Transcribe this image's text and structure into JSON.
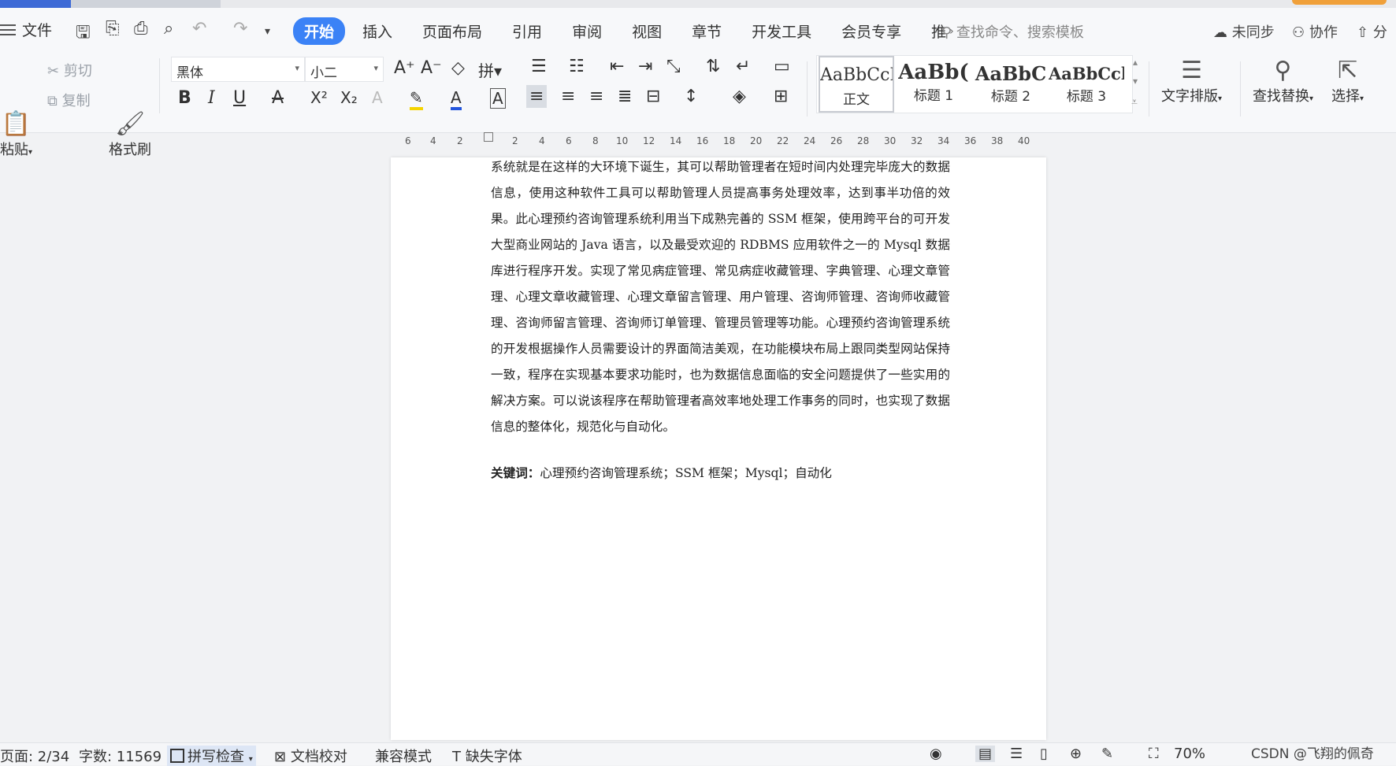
{
  "menu": {
    "file_label": "文件",
    "tabs": [
      "开始",
      "插入",
      "页面布局",
      "引用",
      "审阅",
      "视图",
      "章节",
      "开发工具",
      "会员专享",
      "推"
    ],
    "active_tab": "开始",
    "search_placeholder": "查找命令、搜索模板",
    "sync_status": "未同步",
    "collab": "协作",
    "share": "分"
  },
  "ribbon": {
    "paste": "粘贴",
    "cut": "剪切",
    "copy": "复制",
    "format_painter": "格式刷",
    "font_name": "黑体",
    "font_size": "小二",
    "styles": [
      {
        "preview": "AaBbCcI",
        "name": "正文"
      },
      {
        "preview": "AaBb(",
        "name": "标题 1"
      },
      {
        "preview": "AaBbC",
        "name": "标题 2"
      },
      {
        "preview": "AaBbCcl",
        "name": "标题 3"
      }
    ],
    "text_layout": "文字排版",
    "find_replace": "查找替换",
    "select": "选择"
  },
  "ruler": {
    "ticks": [
      "6",
      "4",
      "2",
      "",
      "2",
      "4",
      "6",
      "8",
      "10",
      "12",
      "14",
      "16",
      "18",
      "20",
      "22",
      "24",
      "26",
      "28",
      "30",
      "32",
      "34",
      "36",
      "38",
      "40"
    ]
  },
  "document": {
    "paragraph": "系统就是在这样的大环境下诞生，其可以帮助管理者在短时间内处理完毕庞大的数据信息，使用这种软件工具可以帮助管理人员提高事务处理效率，达到事半功倍的效果。此心理预约咨询管理系统利用当下成熟完善的 SSM 框架，使用跨平台的可开发大型商业网站的 Java 语言，以及最受欢迎的 RDBMS 应用软件之一的 Mysql 数据库进行程序开发。实现了常见病症管理、常见病症收藏管理、字典管理、心理文章管理、心理文章收藏管理、心理文章留言管理、用户管理、咨询师管理、咨询师收藏管理、咨询师留言管理、咨询师订单管理、管理员管理等功能。心理预约咨询管理系统的开发根据操作人员需要设计的界面简洁美观，在功能模块布局上跟同类型网站保持一致，程序在实现基本要求功能时，也为数据信息面临的安全问题提供了一些实用的解决方案。可以说该程序在帮助管理者高效率地处理工作事务的同时，也实现了数据信息的整体化，规范化与自动化。",
    "keywords_label": "关键词",
    "keywords": "心理预约咨询管理系统；SSM 框架；Mysql；自动化"
  },
  "status": {
    "page": "页面: 2/34",
    "word_count": "字数: 11569",
    "spell_check": "拼写检查",
    "doc_proof": "文档校对",
    "compat_mode": "兼容模式",
    "missing_fonts": "缺失字体",
    "zoom": "70%"
  },
  "watermark": "CSDN @飞翔的佩奇"
}
